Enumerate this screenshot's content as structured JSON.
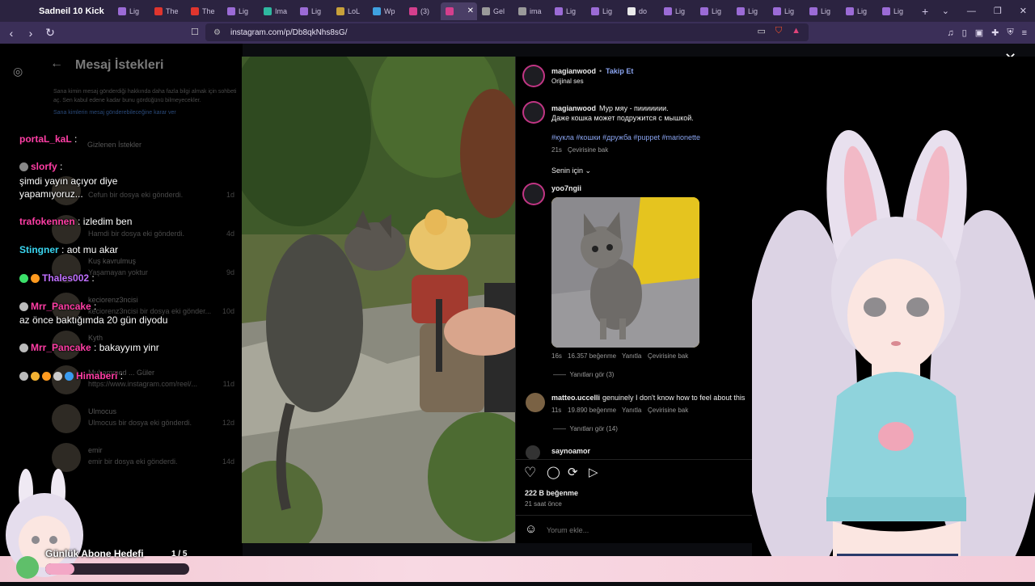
{
  "browser": {
    "window_title": "Sadneil 10 Kick",
    "tabs": [
      {
        "label": "Lig",
        "color": "#9b6bd6"
      },
      {
        "label": "The",
        "color": "#e0352e"
      },
      {
        "label": "The",
        "color": "#e0352e"
      },
      {
        "label": "Lig",
        "color": "#9b6bd6"
      },
      {
        "label": "Ima",
        "color": "#2fb8a0"
      },
      {
        "label": "Lig",
        "color": "#9b6bd6"
      },
      {
        "label": "LoL",
        "color": "#c8a13a"
      },
      {
        "label": "Wp",
        "color": "#3fa1e0"
      },
      {
        "label": "(3)",
        "color": "#d43f8d"
      },
      {
        "label": "",
        "color": "#d43f8d"
      },
      {
        "label": "Gel",
        "color": "#9a9a9a"
      },
      {
        "label": "ima",
        "color": "#9a9a9a"
      },
      {
        "label": "Lig",
        "color": "#9b6bd6"
      },
      {
        "label": "Lig",
        "color": "#9b6bd6"
      },
      {
        "label": "do",
        "color": "#eaeaea"
      },
      {
        "label": "Lig",
        "color": "#9b6bd6"
      },
      {
        "label": "Lig",
        "color": "#9b6bd6"
      },
      {
        "label": "Lig",
        "color": "#9b6bd6"
      },
      {
        "label": "Lig",
        "color": "#9b6bd6"
      },
      {
        "label": "Lig",
        "color": "#9b6bd6"
      },
      {
        "label": "Lig",
        "color": "#9b6bd6"
      },
      {
        "label": "Lig",
        "color": "#9b6bd6"
      }
    ],
    "active_tab_index": 9,
    "url": "instagram.com/p/Db8qkNhs8sG/"
  },
  "dm_panel": {
    "title": "Mesaj İstekleri",
    "description": "Sana kimin mesaj gönderdiği hakkında daha fazla bilgi almak için sohbeti aç. Sen kabul edene kadar bunu gördüğünü bilmeyecekler.",
    "settings_link": "Sana kimlerin mesaj gönderebileceğine karar ver",
    "hidden_requests": "Gizlenen İstekler",
    "rows": [
      {
        "name": "",
        "message": "Cefun bir dosya eki gönderdi.",
        "time": "1d"
      },
      {
        "name": "",
        "message": "Hamdi bir dosya eki gönderdi.",
        "time": "4d"
      },
      {
        "name": "Kuş kavrulmuş",
        "message": "Yaşamayan yoktur",
        "time": "9d"
      },
      {
        "name": "keciorenz3ncisi",
        "message": "keciorenz3ncisi bir dosya eki gönder...",
        "time": "10d"
      },
      {
        "name": "Kyth",
        "message": "",
        "time": ""
      },
      {
        "name": "Muhammed ... Güler",
        "message": "https://www.instagram.com/reel/...",
        "time": "11d"
      },
      {
        "name": "Ulmocus",
        "message": "Ulmocus bir dosya eki gönderdi.",
        "time": "12d"
      },
      {
        "name": "emir",
        "message": "emir bir dosya eki gönderdi.",
        "time": "14d"
      }
    ]
  },
  "chat": [
    {
      "user": "portaL_kaL",
      "user_color": "#ff3ea5",
      "text": "",
      "badges": []
    },
    {
      "user": "slorfy",
      "user_color": "#ff3ea5",
      "text": "",
      "badges": [
        "#888888"
      ]
    },
    {
      "user": "",
      "user_color": "#ffffff",
      "text": "şimdi yayın açıyor diye",
      "badges": []
    },
    {
      "user": "",
      "user_color": "#ffffff",
      "text": "yapamıyoruz...",
      "badges": []
    },
    {
      "user": "trafokennen",
      "user_color": "#ff3ea5",
      "text": "izledim ben",
      "badges": []
    },
    {
      "user": "Stingner",
      "user_color": "#3ad6f0",
      "text": "aot mu akar",
      "badges": []
    },
    {
      "user": "Thales002",
      "user_color": "#c070ff",
      "text": "",
      "badges": [
        "#3be06a",
        "#ff9a1f"
      ]
    },
    {
      "user": "Mrr_Pancake",
      "user_color": "#ff3ea5",
      "text": "",
      "badges": [
        "#bbbbbb"
      ]
    },
    {
      "user": "",
      "user_color": "#ffffff",
      "text": "az önce baktığımda 20 gün diyodu",
      "badges": []
    },
    {
      "user": "Mrr_Pancake",
      "user_color": "#ff3ea5",
      "text": "bakayyım yinr",
      "badges": [
        "#bbbbbb"
      ]
    },
    {
      "user": "Himaberi",
      "user_color": "#ff3ea5",
      "text": "",
      "badges": [
        "#bbbbbb",
        "#f2b233",
        "#ff9a1f",
        "#cccccc",
        "#3b9cf0"
      ]
    }
  ],
  "post": {
    "author": "magianwood",
    "follow_label": "Takip Et",
    "audio": "Orijinal ses",
    "more_icon": "more-horizontal-icon",
    "caption_line1": "Мур мяу - пиииииии.",
    "caption_line2": "Даже кошка может подружится с мышкой.",
    "hashtags": "#кукла #кошки #дружба #puppet #marionette",
    "caption_time": "21s",
    "translate": "Çevirisine bak",
    "sort_label": "Senin için",
    "comments": [
      {
        "user": "yoo7ngii",
        "text": "",
        "time": "16s",
        "likes": "16.357 beğenme",
        "reply": "Yanıtla",
        "translate": "Çevirisine bak",
        "replies": "Yanıtları gör (3)"
      },
      {
        "user": "matteo.uccelli",
        "text": "genuinely I don't know how to feel about this",
        "time": "11s",
        "likes": "19.890 beğenme",
        "reply": "Yanıtla",
        "translate": "Çevirisine bak",
        "replies": "Yanıtları gör (14)"
      },
      {
        "user": "saynoamor",
        "text": "",
        "time": "",
        "likes": "",
        "reply": "",
        "translate": "",
        "replies": ""
      }
    ],
    "likes_total": "222 B beğenme",
    "posted_ago": "21 saat önce",
    "comment_placeholder": "Yorum ekle..."
  },
  "goal": {
    "label": "Günlük Abone Hedefi",
    "count": "1 / 5",
    "progress": 0.2,
    "fill_color": "#f3a7c6"
  }
}
